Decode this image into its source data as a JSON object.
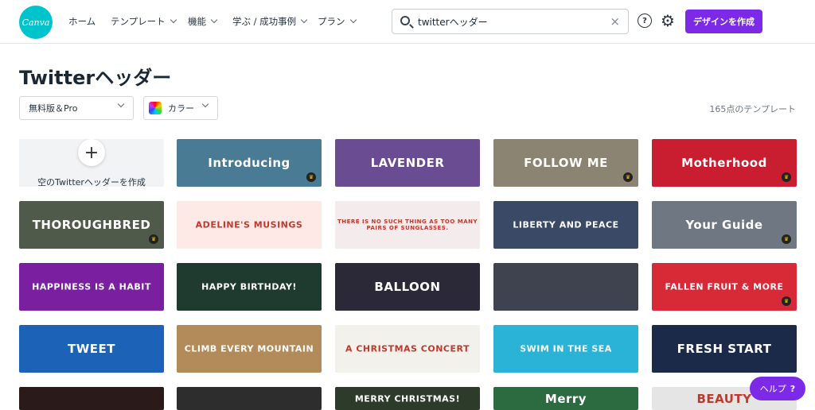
{
  "header": {
    "logo": "Canva",
    "nav": [
      "ホーム",
      "テンプレート",
      "機能",
      "学ぶ / 成功事例",
      "プラン"
    ],
    "search_value": "twitterヘッダー",
    "create_button": "デザインを作成",
    "help_icon": "?",
    "clear_icon": "×",
    "gear_icon": "⚙"
  },
  "page": {
    "title": "Twitterヘッダー",
    "filter_license": "無料版＆Pro",
    "filter_color": "カラー",
    "count": "165点のテンプレート"
  },
  "blank_card": {
    "label": "空のTwitterヘッダーを作成",
    "plus": "+"
  },
  "templates": [
    {
      "text": "Introducing",
      "bg": "#4a7b94",
      "crown": true
    },
    {
      "text": "LAVENDER",
      "bg": "#6a4c93",
      "crown": false
    },
    {
      "text": "FOLLOW ME",
      "bg": "#8b8472",
      "crown": true
    },
    {
      "text": "Motherhood",
      "bg": "#c81e2f",
      "crown": true
    },
    {
      "text": "THOROUGHBRED",
      "bg": "#4f5a4a",
      "crown": true
    },
    {
      "text": "ADELINE'S MUSINGS",
      "bg": "#fde9e6",
      "crown": false
    },
    {
      "text": "THERE IS NO SUCH THING AS TOO MANY PAIRS OF SUNGLASSES.",
      "bg": "#f4ecec",
      "crown": false
    },
    {
      "text": "LIBERTY AND PEACE",
      "bg": "#3a4a66",
      "crown": false
    },
    {
      "text": "Your Guide",
      "bg": "#6f7782",
      "crown": true
    },
    {
      "text": "HAPPINESS IS A HABIT",
      "bg": "#7a1fa0",
      "crown": false
    },
    {
      "text": "HAPPY BIRTHDAY!",
      "bg": "#1f3a2e",
      "crown": false
    },
    {
      "text": "BALLOON",
      "bg": "#2b2838",
      "crown": false
    },
    {
      "text": "",
      "bg": "#3f4350",
      "crown": false
    },
    {
      "text": "FALLEN FRUIT & MORE",
      "bg": "#d72a36",
      "crown": true
    },
    {
      "text": "TWEET",
      "bg": "#1c63b8",
      "crown": false
    },
    {
      "text": "CLIMB EVERY MOUNTAIN",
      "bg": "#b38a5a",
      "crown": false
    },
    {
      "text": "A CHRISTMAS CONCERT",
      "bg": "#f3f1ec",
      "crown": false
    },
    {
      "text": "SWIM IN THE SEA",
      "bg": "#2bb3d7",
      "crown": false
    },
    {
      "text": "FRESH START",
      "bg": "#1c2a4a",
      "crown": false
    },
    {
      "text": "",
      "bg": "#2a1a1a",
      "crown": false
    },
    {
      "text": "",
      "bg": "#2d2d2d",
      "crown": false
    },
    {
      "text": "MERRY CHRISTMAS!",
      "bg": "#2d3c2a",
      "crown": false
    },
    {
      "text": "Merry",
      "bg": "#2b6b3f",
      "crown": false
    },
    {
      "text": "BEAUTY",
      "bg": "#e5e5e5",
      "crown": false
    }
  ],
  "help_button": {
    "label": "ヘルプ",
    "icon": "?"
  },
  "colors": {
    "accent": "#7d2ae8",
    "logo": "#00c4cc"
  }
}
